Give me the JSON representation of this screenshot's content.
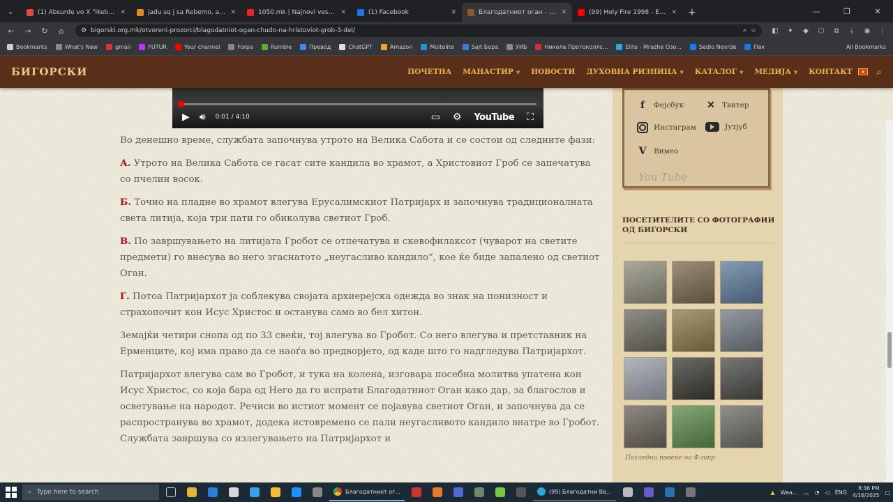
{
  "browser": {
    "tabs": [
      {
        "label": "(1) Absurde vo X \"Ikeben\"",
        "color": "#e44"
      },
      {
        "label": "jadu sq j sa Rebemo, arop...",
        "color": "#e38b1c"
      },
      {
        "label": "1050.mk | Najnovi vesti od Mak...",
        "color": "#e22"
      },
      {
        "label": "(1) Facebook",
        "color": "#1877f2"
      },
      {
        "label": "Благодатниот оган - Чудо на...",
        "color": "#8a5a2a"
      },
      {
        "label": "(99) Holy Fire 1998 - English -",
        "color": "#f00"
      }
    ],
    "active_tab": 4,
    "url": "bigorski.org.mk/otvoreni-prozorci/blagodatniot-ogan-chudo-na-hristoviot-grob-3-del/",
    "bookmarks": [
      {
        "label": "Bookmarks",
        "color": "#cfcfcf"
      },
      {
        "label": "What's New",
        "color": "#888"
      },
      {
        "label": "gmail",
        "color": "#d33"
      },
      {
        "label": "FUTUR",
        "color": "#b3f"
      },
      {
        "label": "Your channel",
        "color": "#f00"
      },
      {
        "label": "Forpa",
        "color": "#888"
      },
      {
        "label": "Rumble",
        "color": "#5fae2a"
      },
      {
        "label": "Превод",
        "color": "#4285f4"
      },
      {
        "label": "ChatGPT",
        "color": "#ddd"
      },
      {
        "label": "Amazon",
        "color": "#e8a33b"
      },
      {
        "label": "Moitelite",
        "color": "#2a8fd8"
      },
      {
        "label": "Sajt Бора",
        "color": "#3b7ad8"
      },
      {
        "label": "УИБ",
        "color": "#888"
      },
      {
        "label": "Никола Протоколлс...",
        "color": "#c33"
      },
      {
        "label": "Elite - Mrazhe Озо...",
        "color": "#2aa7d8"
      },
      {
        "label": "Sedlo Nevrde",
        "color": "#1877f2"
      },
      {
        "label": "Пак",
        "color": "#1877f2"
      }
    ],
    "all_bookmarks": "All Bookmarks"
  },
  "site": {
    "logo": "БИГОРСКИ",
    "nav": [
      {
        "label": "ПОЧЕТНА",
        "dropdown": false
      },
      {
        "label": "МАНАСТИР",
        "dropdown": true
      },
      {
        "label": "НОВОСТИ",
        "dropdown": false
      },
      {
        "label": "ДУХОВНА РИЗНИЦА",
        "dropdown": true
      },
      {
        "label": "КАТАЛОГ",
        "dropdown": true
      },
      {
        "label": "МЕДИЈА",
        "dropdown": true
      },
      {
        "label": "КОНТАКТ",
        "dropdown": false
      }
    ]
  },
  "video": {
    "time": "0:01 / 4:10",
    "progress_fraction": 0.004,
    "brand": "YouTube"
  },
  "article": {
    "intro": "Во денешно време, службата започнува утрото на Велика Сабота и се состои од следните фази:",
    "steps": [
      {
        "mark": "А.",
        "text": "Утрото на Велика Сабота се гасат сите кандила во храмот, а Христовиот Гроб се запечатува со пчелин восок."
      },
      {
        "mark": "Б.",
        "text": "Точно на пладне во храмот влегува Ерусалимскиот Патријарх и започнува традиционалната света литија, која три пати го обиколува светиот Гроб."
      },
      {
        "mark": "В.",
        "text": "По завршувањето на литијата Гробот се отпечатува и скевофилаксот (чуварот на светите предмети) го внесува во него згаснатото „неугасливо кандило“, кое ќе биде запалено од светиот Оган."
      },
      {
        "mark": "Г.",
        "text": "Потоа Патријархот ја соблекува својата архиерејска одежда во знак на понизност и страхопочит кон Исус Христос и останува само во бел хитон."
      }
    ],
    "para1": "Земајќи четири снопа од по 33 свеќи, тој влегува во Гробот. Со него влегува и претставник на Ерменците, кој има право да се наоѓа во предворјето, од каде што го надгледува Патријархот.",
    "para2": "Патријархот влегува сам во Гробот, и тука на колена, изговара посебна молитва упатена кон Исус Христос, со која бара од Него да го испрати Благодатниот Оган како дар, за благослов и осветување на народот. Речиси во истиот момент се појавува светиот Оган, и започнува да се распространува во храмот, додека истовремено се пали неугасливото кандило внатре во Гробот. Службата завршува со излегувањето на Патријархот и"
  },
  "sidebar": {
    "social": {
      "facebook": "Фејсбук",
      "twitter": "Твитер",
      "instagram": "Инстаграм",
      "youtube": "Јутјуб",
      "vimeo": "Вимео",
      "signature": "You Tube"
    },
    "visitors_title": "ПОСЕТИТЕЛИТЕ СО ФОТОГРАФИИ ОД БИГОРСКИ",
    "thumbs": [
      "#8c8c7c",
      "#7a6a50",
      "#5a7a9a",
      "#6a6a60",
      "#8a7a4a",
      "#707a80",
      "#9aa0a8",
      "#3a3a34",
      "#4a4a48",
      "#6a625a",
      "#5a8a4a",
      "#6a6a66"
    ],
    "gallery_caption": "Погледни повеќе на Фликр"
  },
  "taskbar": {
    "search_placeholder": "Type here to search",
    "active_app": "Благодатниот ог...",
    "chrome_window_2": "(99) Благодатни Ва...",
    "weather": "Wea...",
    "lang": "ENG",
    "time": "8:36 PM",
    "date": "4/16/2025"
  }
}
